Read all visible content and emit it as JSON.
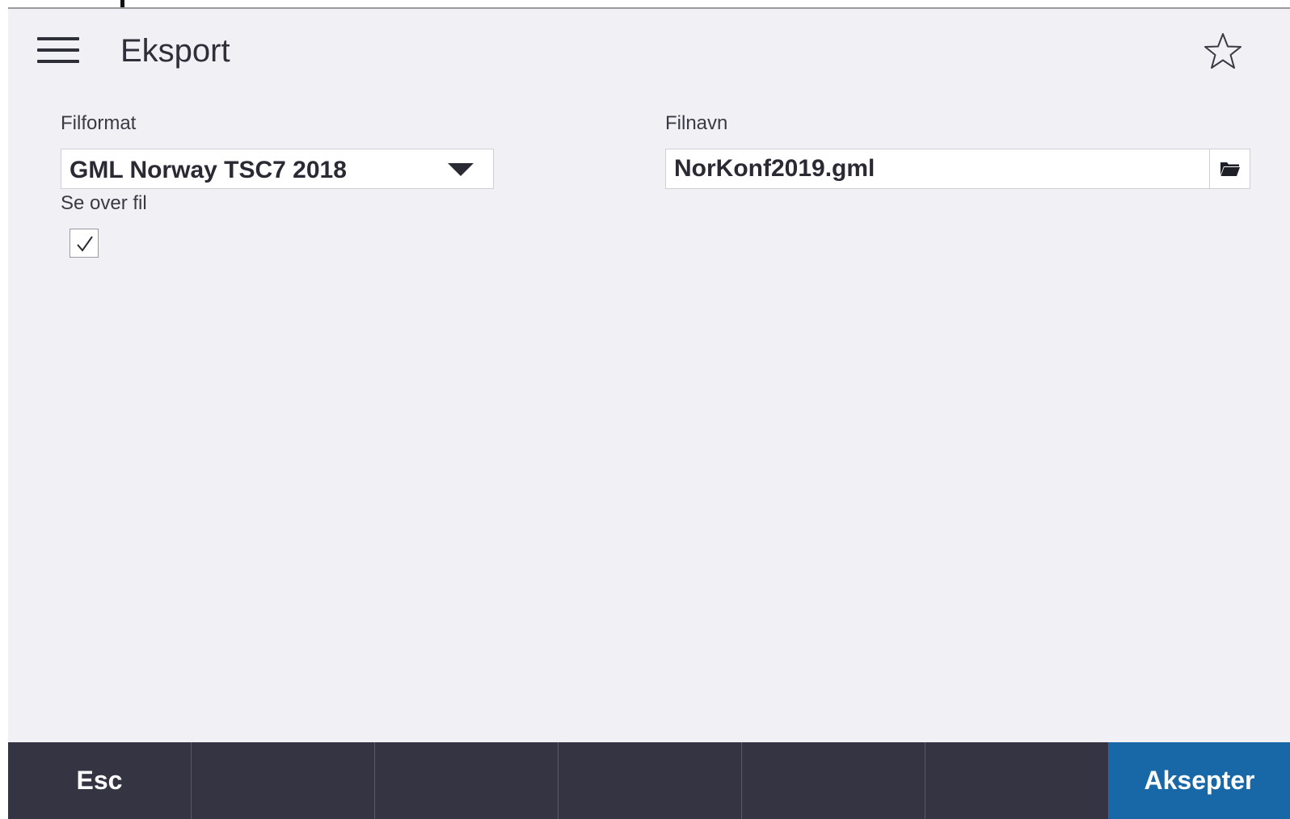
{
  "header": {
    "title": "Eksport"
  },
  "form": {
    "file_format": {
      "label": "Filformat",
      "selected": "GML Norway TSC7 2018"
    },
    "file_name": {
      "label": "Filnavn",
      "value": "NorKonf2019.gml"
    },
    "preview": {
      "label": "Se over fil",
      "checked": true
    }
  },
  "softkeys": {
    "esc": "Esc",
    "key2": "",
    "key3": "",
    "key4": "",
    "key5": "",
    "key6": "",
    "accept": "Aksepter"
  },
  "colors": {
    "background": "#f1f1f5",
    "bar": "#343442",
    "accent": "#1868a8"
  },
  "icons": {
    "menu": "menu-icon",
    "favorite": "star-outline-icon",
    "browse": "folder-icon",
    "dropdown": "caret-down-icon",
    "check": "checkmark-icon"
  }
}
